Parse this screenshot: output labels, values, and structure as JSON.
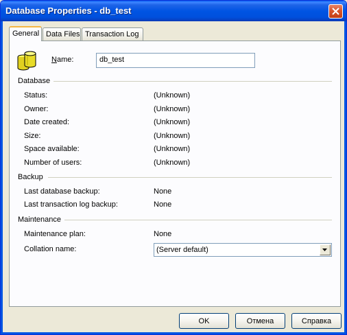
{
  "window": {
    "title": "Database Properties - db_test"
  },
  "tabs": [
    {
      "label": "General"
    },
    {
      "label": "Data Files"
    },
    {
      "label": "Transaction Log"
    }
  ],
  "general": {
    "name_label_prefix": "N",
    "name_label_rest": "ame:",
    "name_value": "db_test",
    "database_group": "Database",
    "database_rows": [
      {
        "label": "Status:",
        "value": "(Unknown)"
      },
      {
        "label": "Owner:",
        "value": "(Unknown)"
      },
      {
        "label": "Date created:",
        "value": "(Unknown)"
      },
      {
        "label": "Size:",
        "value": "(Unknown)"
      },
      {
        "label": "Space available:",
        "value": "(Unknown)"
      },
      {
        "label": "Number of users:",
        "value": "(Unknown)"
      }
    ],
    "backup_group": "Backup",
    "backup_rows": [
      {
        "label": "Last database backup:",
        "value": "None"
      },
      {
        "label": "Last transaction log backup:",
        "value": "None"
      }
    ],
    "maintenance_group": "Maintenance",
    "maintenance_plan_label": "Maintenance plan:",
    "maintenance_plan_value": "None",
    "collation_label": "Collation name:",
    "collation_value": "(Server default)"
  },
  "buttons": {
    "ok": "OK",
    "cancel": "Отмена",
    "help": "Справка"
  },
  "colors": {
    "titlebar": "#0054E3",
    "close": "#C13E14",
    "active_tab_accent": "#F5B642"
  }
}
